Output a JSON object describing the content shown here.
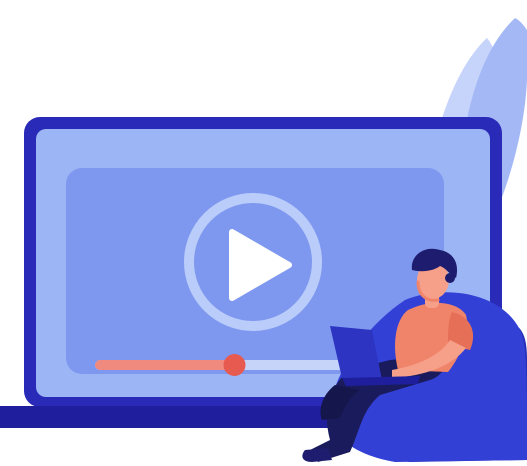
{
  "illustration": {
    "video_progress": 0.45,
    "colors": {
      "monitor_frame": "#2A2AB8",
      "monitor_screen": "#9CB5F5",
      "video_panel": "#7F98EF",
      "play_ring": "#B9CCFA",
      "play_triangle": "#FFFFFF",
      "progress_played": "#F08A7E",
      "progress_knob": "#E65A50",
      "progress_track": "#C7D4FA",
      "base_bar": "#1F1F9E",
      "leaves_light": "#C6D3FB",
      "leaves_mid": "#A5B8F6",
      "beanbag": "#3340D6",
      "beanbag_shadow": "#232FB4",
      "shirt": "#F0846A",
      "skin": "#F6A08A",
      "hair": "#1D1C6E",
      "pants": "#1A1B5C",
      "laptop": "#2D34C2",
      "headset": "#F0846A"
    }
  }
}
